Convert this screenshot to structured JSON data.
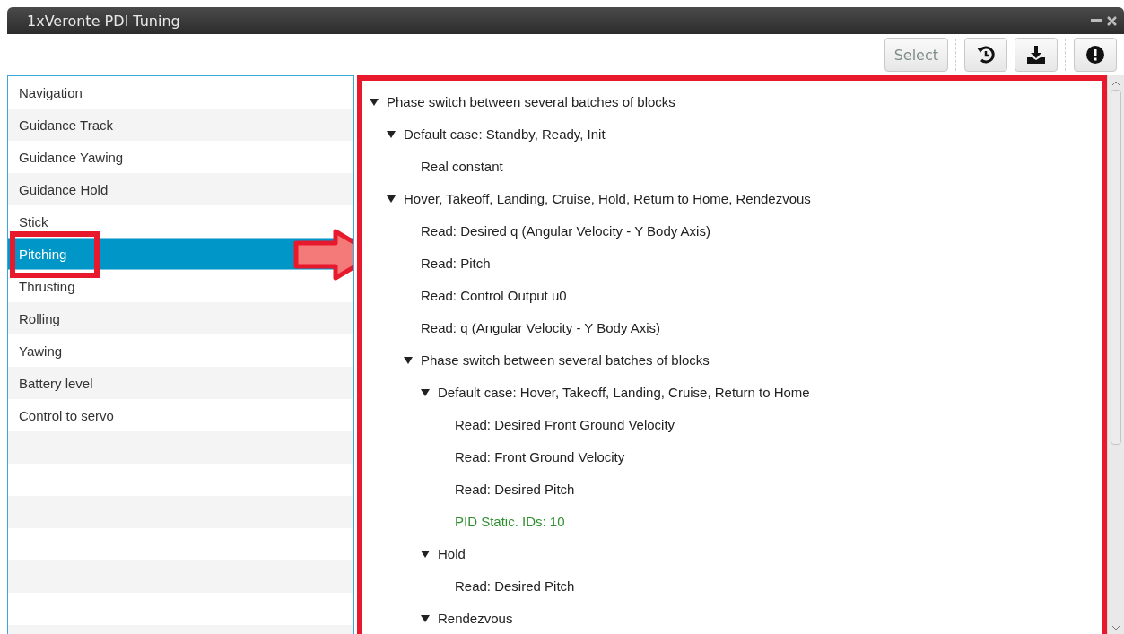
{
  "window": {
    "title": "1xVeronte PDI Tuning"
  },
  "toolbar": {
    "select_button": {
      "label": "Select",
      "disabled": true
    }
  },
  "sidebar": {
    "items": [
      {
        "label": "Navigation",
        "selected": false
      },
      {
        "label": "Guidance Track",
        "selected": false
      },
      {
        "label": "Guidance Yawing",
        "selected": false
      },
      {
        "label": "Guidance Hold",
        "selected": false
      },
      {
        "label": "Stick",
        "selected": false
      },
      {
        "label": "Pitching",
        "selected": true
      },
      {
        "label": "Thrusting",
        "selected": false
      },
      {
        "label": "Rolling",
        "selected": false
      },
      {
        "label": "Yawing",
        "selected": false
      },
      {
        "label": "Battery level",
        "selected": false
      },
      {
        "label": "Control to servo",
        "selected": false
      }
    ]
  },
  "tree": [
    {
      "label": "Phase switch between several batches of blocks",
      "expanded": true,
      "children": [
        {
          "label": "Default case: Standby, Ready, Init",
          "expanded": true,
          "children": [
            {
              "label": "Real constant"
            }
          ]
        },
        {
          "label": "Hover, Takeoff, Landing, Cruise, Hold, Return to Home, Rendezvous",
          "expanded": true,
          "children": [
            {
              "label": "Read: Desired q (Angular Velocity - Y Body Axis)"
            },
            {
              "label": "Read: Pitch"
            },
            {
              "label": "Read: Control Output u0"
            },
            {
              "label": "Read: q (Angular Velocity - Y Body Axis)"
            },
            {
              "label": "Phase switch between several batches of blocks",
              "expanded": true,
              "children": [
                {
                  "label": "Default case: Hover, Takeoff, Landing, Cruise, Return to Home",
                  "expanded": true,
                  "children": [
                    {
                      "label": "Read: Desired Front Ground Velocity"
                    },
                    {
                      "label": "Read: Front Ground Velocity"
                    },
                    {
                      "label": "Read: Desired Pitch"
                    },
                    {
                      "label": "PID Static. IDs: 10",
                      "color": "#2f8f2f"
                    }
                  ]
                },
                {
                  "label": "Hold",
                  "expanded": true,
                  "children": [
                    {
                      "label": "Read: Desired Pitch"
                    }
                  ]
                },
                {
                  "label": "Rendezvous",
                  "expanded": true
                }
              ]
            }
          ]
        }
      ]
    }
  ]
}
